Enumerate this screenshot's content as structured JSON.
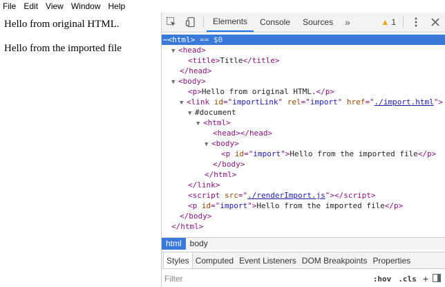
{
  "menubar": {
    "items": [
      "File",
      "Edit",
      "View",
      "Window",
      "Help"
    ]
  },
  "page": {
    "para1": "Hello from original HTML.",
    "para2": "Hello from the imported file"
  },
  "devtools": {
    "tabs": [
      "Elements",
      "Console",
      "Sources"
    ],
    "active_tab": "Elements",
    "warning_count": "1",
    "tree": {
      "html_open_selected": "<html>",
      "selected_suffix": " == $0",
      "head_open": "<head>",
      "title_line": "Title",
      "head_close": "</head>",
      "body_open": "<body>",
      "p1_text": "Hello from original HTML.",
      "link_id": "importLink",
      "link_rel": "import",
      "link_href": "./import.html",
      "document": "#document",
      "import_p_id": "import",
      "import_p_text": "Hello from the imported file",
      "script_src": "./renderImport.js",
      "p2_id": "import",
      "p2_text": "Hello from the imported file"
    },
    "breadcrumbs": [
      "html",
      "body"
    ],
    "active_crumb": "html",
    "styles_tabs": [
      "Styles",
      "Computed",
      "Event Listeners",
      "DOM Breakpoints",
      "Properties"
    ],
    "filter_placeholder": "Filter",
    "hov": ":hov",
    "cls": ".cls"
  }
}
